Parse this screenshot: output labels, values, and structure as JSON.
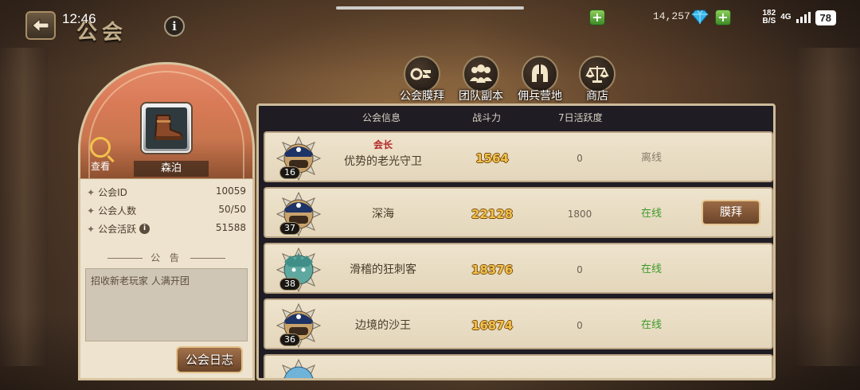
{
  "status_bar": {
    "time": "12:46",
    "net_speed": "182\nB/S",
    "network": "4G",
    "battery": "78"
  },
  "header": {
    "title": "公会",
    "info_label": "i"
  },
  "resources": {
    "diamonds": "14,257"
  },
  "top_menu": [
    {
      "label": "公会膜拜",
      "icon": "handshake-icon"
    },
    {
      "label": "团队副本",
      "icon": "team-icon"
    },
    {
      "label": "佣兵营地",
      "icon": "helmet-icon"
    },
    {
      "label": "商店",
      "icon": "scales-icon"
    }
  ],
  "guild": {
    "name": "森泊",
    "view_label": "查看",
    "stats": [
      {
        "label": "公会ID",
        "value": "10059"
      },
      {
        "label": "公会人数",
        "value": "50/50"
      },
      {
        "label": "公会活跃",
        "value": "51588"
      }
    ],
    "announcement_title": "公 告",
    "announcement_text": "招收新老玩家 人满开团",
    "log_button": "公会日志"
  },
  "table": {
    "headers": [
      "公会信息",
      "战斗力",
      "7日活跃度"
    ],
    "rows": [
      {
        "level": "16",
        "title": "会长",
        "name": "优势的老光守卫",
        "power": "1564",
        "activity": "0",
        "status": "离线",
        "online": false,
        "button": ""
      },
      {
        "level": "37",
        "title": "",
        "name": "深海",
        "power": "22128",
        "activity": "1800",
        "status": "在线",
        "online": true,
        "button": "膜拜"
      },
      {
        "level": "38",
        "title": "",
        "name": "滑稽的狂刺客",
        "power": "18376",
        "activity": "0",
        "status": "在线",
        "online": true,
        "button": ""
      },
      {
        "level": "36",
        "title": "",
        "name": "边境的沙王",
        "power": "16874",
        "activity": "0",
        "status": "在线",
        "online": true,
        "button": ""
      }
    ]
  },
  "colors": {
    "accent_gold": "#f2c14b",
    "online_green": "#3d9a2a",
    "leader_red": "#b3262a"
  }
}
